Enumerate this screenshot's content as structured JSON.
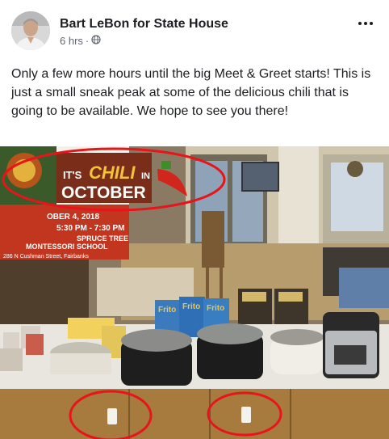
{
  "post": {
    "author": "Bart LeBon for State House",
    "time": "6 hrs",
    "separator": "·",
    "audience_icon": "globe-icon",
    "more_icon": "more-options-icon",
    "text": "Only a few more hours until the big Meet & Greet starts! This is just a small sneak peak at some of the delicious chili that is going to be available. We hope to see you there!"
  },
  "photo": {
    "flyer": {
      "its": "IT'S",
      "chili": "CHILI",
      "in": "IN",
      "october": "OCTOBER",
      "date": "OBER 4, 2018",
      "time": "5:30 PM - 7:30 PM",
      "venue_line1": "SPRUCE TREE",
      "venue_line2": "MONTESSORI SCHOOL",
      "address": "286 N Cushman Street, Fairbanks"
    },
    "chip_bag_labels": [
      "Frito",
      "Frito",
      "Frito"
    ],
    "annotation_color": "#e8141b"
  }
}
